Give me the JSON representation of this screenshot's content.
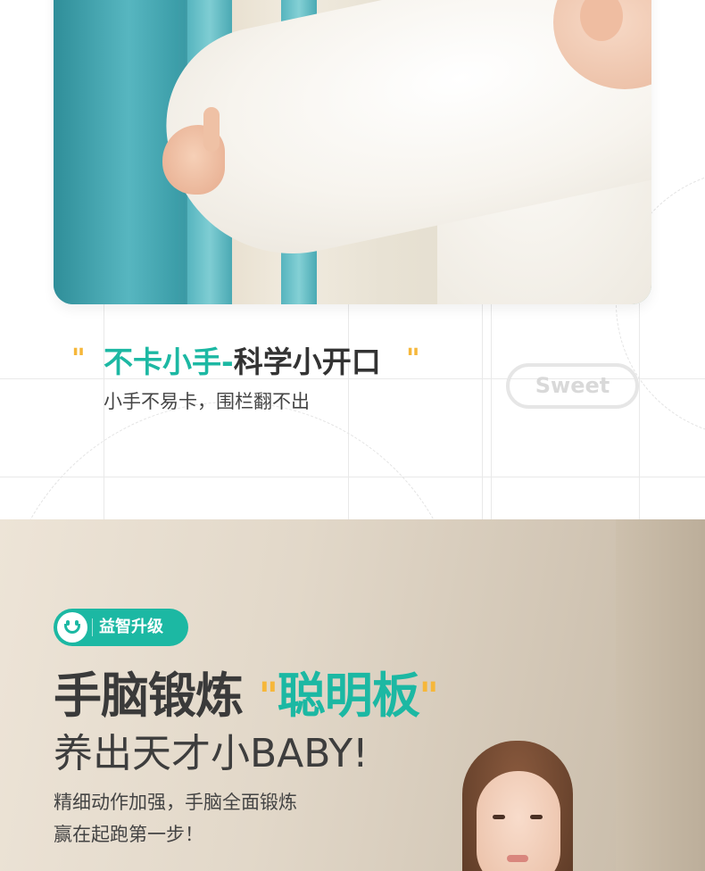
{
  "feature": {
    "quote_open": "\"",
    "headline_highlight": "不卡小手-",
    "headline_rest": "科学小开口",
    "quote_close": "\"",
    "subtitle": "小手不易卡，围栏翻不出",
    "badge": "Sweet"
  },
  "promo": {
    "tag_label": "益智升级",
    "title_main": "手脑锻炼",
    "title_quote_open": "\"",
    "title_highlight": "聪明板",
    "title_quote_close": "\"",
    "subtitle": "养出天才小BABY!",
    "desc_line1": "精细动作加强，手脑全面锻炼",
    "desc_line2": "赢在起跑第一步！"
  },
  "colors": {
    "accent": "#1cb8a3",
    "quote": "#f6b73a",
    "text": "#333333"
  },
  "icons": {
    "tag_icon": "smiley-face-icon"
  }
}
